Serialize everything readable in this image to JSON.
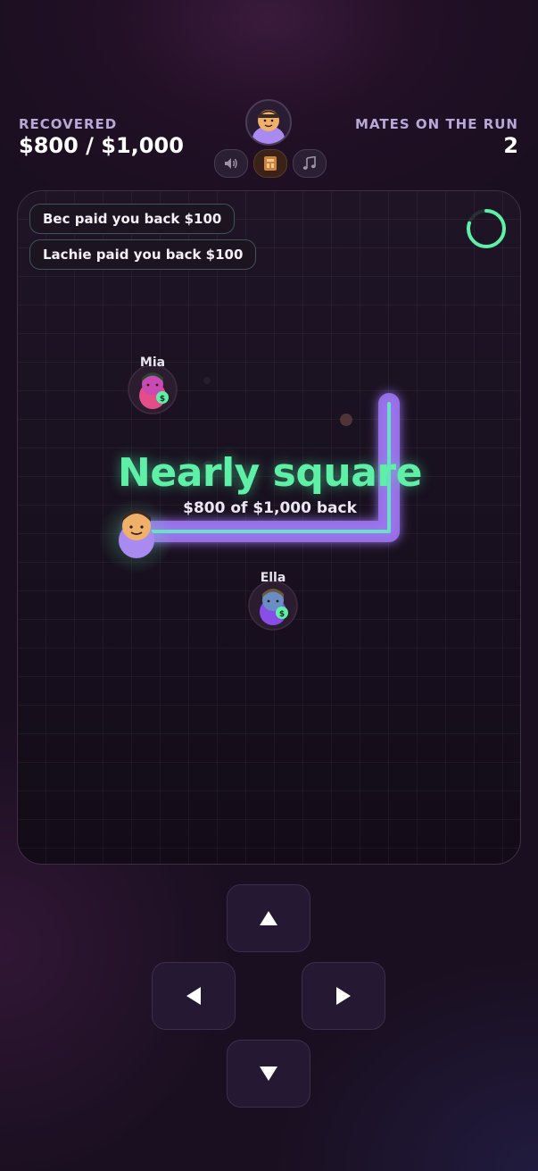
{
  "hud": {
    "recovered_label": "RECOVERED",
    "recovered_value": "$800 / $1,000",
    "mates_label": "MATES ON THE RUN",
    "mates_value": "2",
    "icons": [
      "speaker-icon",
      "book-icon",
      "music-note-icon"
    ]
  },
  "progress_ring": {
    "fraction": 0.8,
    "color": "#5ff0a8"
  },
  "toasts": [
    "Bec paid you back $100",
    "Lachie paid you back $100"
  ],
  "banner": {
    "title": "Nearly square",
    "subtitle": "$800 of $1,000 back"
  },
  "mates": [
    {
      "name": "Mia"
    },
    {
      "name": "Ella"
    }
  ],
  "controls": [
    "up",
    "left",
    "right",
    "down"
  ],
  "colors": {
    "accent_green": "#5ff0a8",
    "trail_purple": "#a37bf5",
    "player_body": "#a98af0"
  }
}
